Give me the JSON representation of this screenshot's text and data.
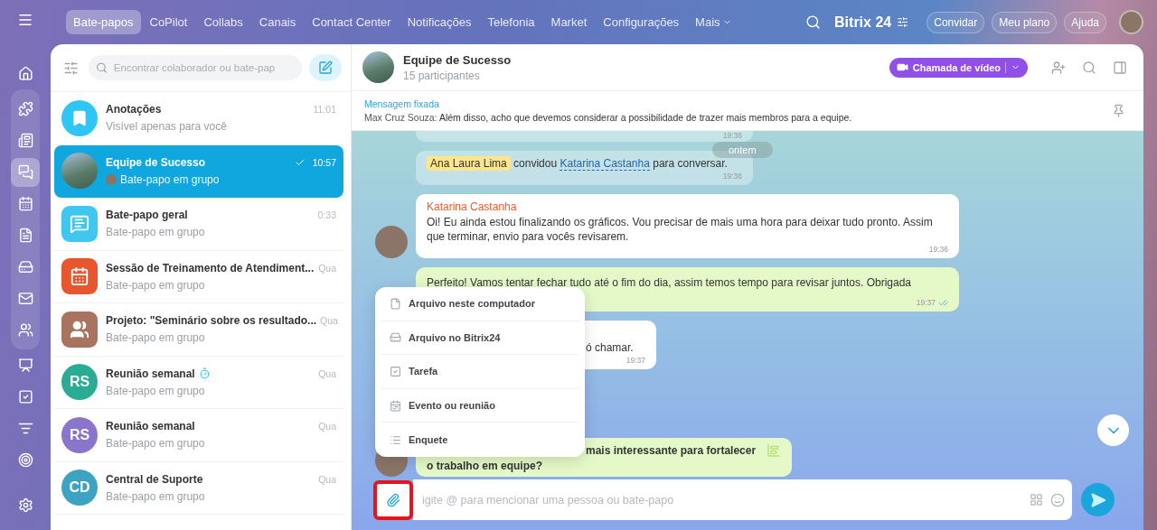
{
  "topnav": {
    "items": [
      {
        "label": "Bate-papos",
        "selected": true
      },
      {
        "label": "CoPilot",
        "selected": false
      },
      {
        "label": "Collabs",
        "selected": false
      },
      {
        "label": "Canais",
        "selected": false
      },
      {
        "label": "Contact Center",
        "selected": false
      },
      {
        "label": "Notificações",
        "selected": false
      },
      {
        "label": "Telefonia",
        "selected": false
      },
      {
        "label": "Market",
        "selected": false
      },
      {
        "label": "Configurações",
        "selected": false
      },
      {
        "label": "Mais",
        "selected": false,
        "dropdown": true
      }
    ],
    "brand": "Bitrix",
    "brand_number": "24",
    "buttons": [
      "Convidar",
      "Meu plano",
      "Ajuda"
    ]
  },
  "rail": {
    "items": [
      {
        "kind": "home",
        "selected": false
      },
      {
        "kind": "puzzle",
        "selected": false
      },
      {
        "kind": "news",
        "selected": false
      },
      {
        "kind": "chats",
        "selected": true
      },
      {
        "kind": "calendar",
        "selected": false
      },
      {
        "kind": "document",
        "selected": false
      },
      {
        "kind": "drive",
        "selected": false
      },
      {
        "kind": "mail",
        "selected": false
      },
      {
        "kind": "users",
        "selected": false
      },
      {
        "kind": "board",
        "selected": false
      },
      {
        "kind": "task",
        "selected": false
      },
      {
        "kind": "funnel",
        "selected": false
      },
      {
        "kind": "target",
        "selected": false
      }
    ]
  },
  "chat_list": {
    "search": {
      "placeholder": "Encontrar colaborador ou bate-pap"
    },
    "items": [
      {
        "kind": "bookmark",
        "title": "Anotações",
        "subtitle": "Visível apenas para você",
        "time": "11:01",
        "selected": false,
        "read": false,
        "timer": false,
        "sender_avatar": false,
        "color": "#2fc6f6"
      },
      {
        "kind": "photo",
        "title": "Equipe de Sucesso",
        "subtitle": "Bate-papo em grupo",
        "time": "10:57",
        "selected": true,
        "read": true,
        "timer": false,
        "sender_avatar": true
      },
      {
        "kind": "chat",
        "title": "Bate-papo geral",
        "subtitle": "Bate-papo em grupo",
        "time": "0:33",
        "selected": false,
        "read": false,
        "timer": false,
        "sender_avatar": false,
        "color": "#3fc7f0"
      },
      {
        "kind": "calendar",
        "title": "Sessão de Treinamento de Atendiment...",
        "subtitle": "Bate-papo em grupo",
        "time": "Qua",
        "selected": false,
        "read": false,
        "timer": false,
        "sender_avatar": false,
        "color": "#e8562f"
      },
      {
        "kind": "group",
        "title": "Projeto: \"Seminário sobre os resultado...",
        "subtitle": "Bate-papo em grupo",
        "time": "Qua",
        "selected": false,
        "read": false,
        "timer": false,
        "sender_avatar": false,
        "color": "#a8735f"
      },
      {
        "kind": "initials",
        "title": "Reunião semanal",
        "subtitle": "Bate-papo em grupo",
        "time": "Qua",
        "selected": false,
        "read": false,
        "timer": true,
        "sender_avatar": false,
        "initials": "RS",
        "color": "#29ab94"
      },
      {
        "kind": "initials",
        "title": "Reunião semanal",
        "subtitle": "Bate-papo em grupo",
        "time": "Qua",
        "selected": false,
        "read": false,
        "timer": false,
        "sender_avatar": false,
        "initials": "RS",
        "color": "#8a74cc"
      },
      {
        "kind": "initials",
        "title": "Central de Suporte",
        "subtitle": "Bate-papo em grupo",
        "time": "Qua",
        "selected": false,
        "read": false,
        "timer": false,
        "sender_avatar": false,
        "initials": "CD",
        "color": "#3ea2c2"
      }
    ]
  },
  "chat": {
    "title": "Equipe de Sucesso",
    "subtitle": "15 participantes",
    "call_button": "Chamada de vídeo",
    "pinned": {
      "label": "Mensagem fixada",
      "author": "Max Cruz Souza:",
      "text": "Além disso, acho que devemos considerar a possibilidade de trazer mais membros para a equipe."
    },
    "date_pill": "ontem",
    "messages": [
      {
        "kind": "cut",
        "time": "19:36"
      },
      {
        "kind": "system",
        "mention": "Ana Laura Lima",
        "before": "convidou",
        "link": "Katarina Castanha",
        "after": "para conversar.",
        "time": "19:36"
      },
      {
        "kind": "incoming",
        "author": "Katarina Castanha",
        "text": "Oi! Eu ainda estou finalizando os gráficos. Vou precisar de mais uma hora para deixar tudo pronto. Assim que terminar, envio para vocês revisarem.",
        "time": "19:36"
      },
      {
        "kind": "outgoing",
        "text": "Perfeito! Vamos tentar fechar tudo até o fim do dia, assim temos tempo para revisar juntos. Obrigada",
        "time": "19:37",
        "read": true
      },
      {
        "kind": "covered_incoming",
        "text": "ó chamar.",
        "time": "19:37"
      },
      {
        "kind": "covered_poll",
        "line1": "mais interessante para fortalecer",
        "line2": "o trabalho em equipe?"
      }
    ],
    "attach_menu": [
      {
        "kind": "file",
        "label": "Arquivo neste computador"
      },
      {
        "kind": "drive",
        "label": "Arquivo no Bitrix24"
      },
      {
        "kind": "task",
        "label": "Tarefa"
      },
      {
        "kind": "event",
        "label": "Evento ou reunião"
      },
      {
        "kind": "poll",
        "label": "Enquete"
      }
    ],
    "input": {
      "placeholder": "igite @ para mencionar uma pessoa ou bate-papo"
    }
  }
}
